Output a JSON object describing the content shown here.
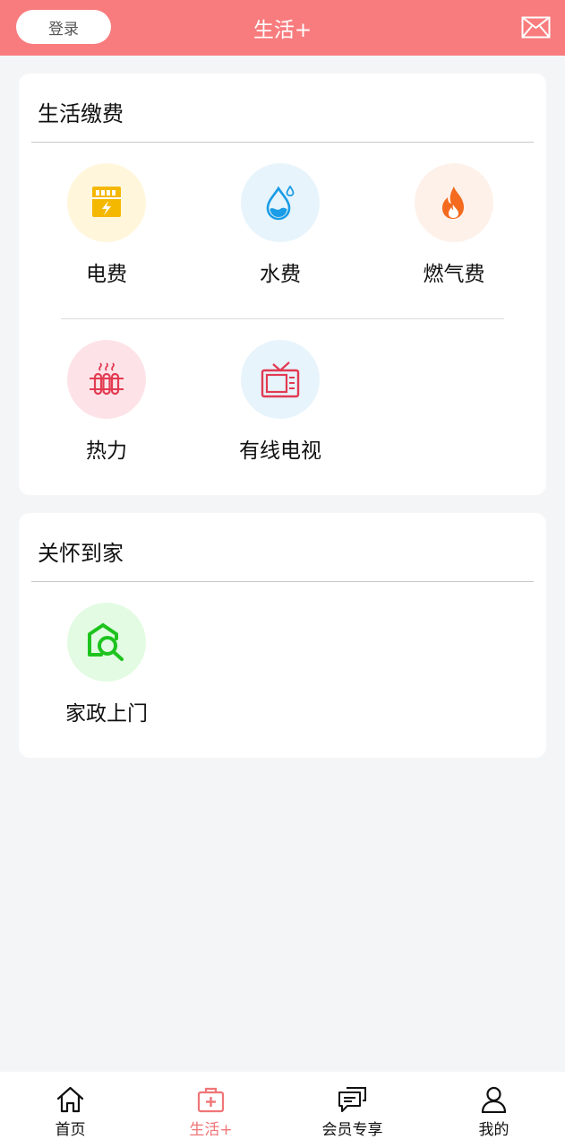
{
  "header": {
    "login_label": "登录",
    "title": "生活+",
    "mail_icon": "mail-icon",
    "bg_color": "#f87c7e"
  },
  "life_payment": {
    "title": "生活缴费",
    "items": [
      {
        "label": "电费",
        "icon": "electricity-icon",
        "bg": "#fff6dc",
        "color": "#f5b800"
      },
      {
        "label": "水费",
        "icon": "water-drop-icon",
        "bg": "#e7f4fc",
        "color": "#1a9ce6"
      },
      {
        "label": "燃气费",
        "icon": "flame-icon",
        "bg": "#fdf1ea",
        "color": "#f46a1e"
      },
      {
        "label": "热力",
        "icon": "radiator-icon",
        "bg": "#fde3e8",
        "color": "#e23a52"
      },
      {
        "label": "有线电视",
        "icon": "tv-icon",
        "bg": "#e7f4fc",
        "color": "#e23a52"
      }
    ]
  },
  "care_home": {
    "title": "关怀到家",
    "items": [
      {
        "label": "家政上门",
        "icon": "home-search-icon",
        "bg": "#e2fbe2",
        "color": "#1ec31e"
      }
    ]
  },
  "tabbar": {
    "active_color": "#f07577",
    "tabs": [
      {
        "label": "首页",
        "icon": "home-icon"
      },
      {
        "label": "生活+",
        "icon": "life-kit-icon"
      },
      {
        "label": "会员专享",
        "icon": "chat-icon"
      },
      {
        "label": "我的",
        "icon": "user-icon"
      }
    ]
  }
}
